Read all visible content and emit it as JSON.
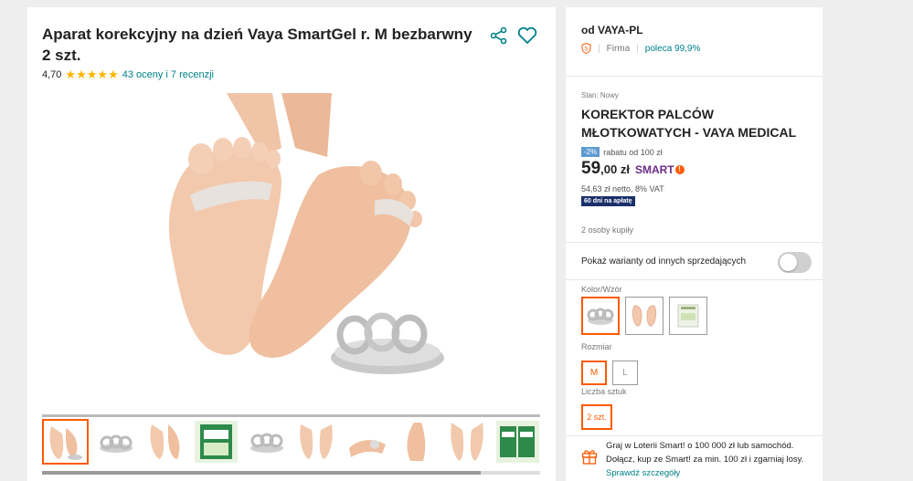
{
  "product": {
    "title": "Aparat korekcyjny na dzień Vaya SmartGel r. M bezbarwny 2 szt.",
    "rating_value": "4,70",
    "stars": "★★★★★",
    "reviews_link": "43 oceny i 7 recenzji",
    "thumbnail_count": 10
  },
  "seller": {
    "name": "od VAYA-PL",
    "type": "Firma",
    "recommendation": "poleca 99,9%"
  },
  "offer": {
    "condition": "Stan: Nowy",
    "name": "KOREKTOR PALCÓW MŁOTKOWATYCH - VAYA MEDICAL",
    "discount_badge": "-2%",
    "discount_text": "rabatu od 100 zł",
    "price_main": "59",
    "price_rest": ",00 zł",
    "smart_label": "SMART",
    "smart_dot": "!",
    "netto": "54,63 zł netto, 8% VAT",
    "payment_badge": "60 dni na apłatę",
    "bought": "2 osoby kupiły"
  },
  "variants": {
    "toggle_label": "Pokaż warianty od innych sprzedających",
    "toggle_on": false,
    "color_label": "Kolor/Wzór",
    "size_label": "Rozmiar",
    "sizes": [
      "M",
      "L"
    ],
    "selected_size": "M",
    "qty_label": "Liczba sztuk",
    "qty_value": "2 szt."
  },
  "promo": {
    "text": "Graj w Loterii Smart! o 100 000 zł lub samochód. Dołącz, kup ze Smart! za min. 100 zł i zgarniaj losy.",
    "link": "Sprawdź szczegóły"
  },
  "colors": {
    "accent": "#ff5a00",
    "teal": "#00808a",
    "star": "#ffb400",
    "smart_purple": "#6b2b87",
    "badge_navy": "#1b2f6b"
  },
  "icons": [
    "share-icon",
    "heart-icon",
    "shield-icon",
    "gift-icon"
  ]
}
